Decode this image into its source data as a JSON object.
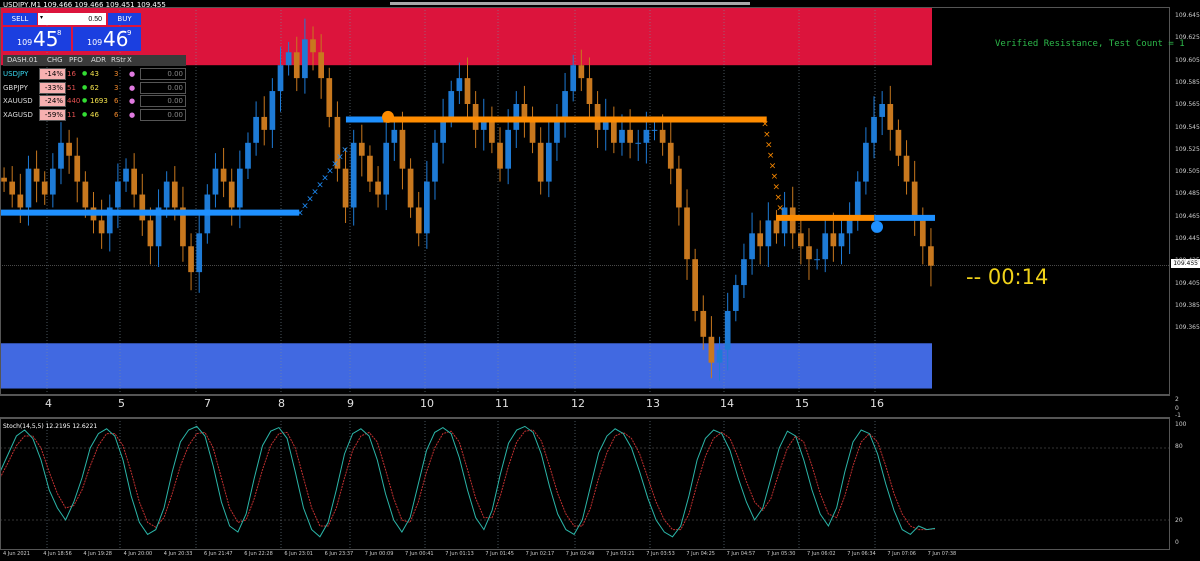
{
  "window": {
    "title": "USDJPY,M1  109.466 109.466 109.451 109.455"
  },
  "trade_panel": {
    "sell_label": "SELL",
    "buy_label": "BUY",
    "lot_value": "0.50",
    "sell_price": {
      "small": "109",
      "big": "45",
      "sup": "8"
    },
    "buy_price": {
      "small": "109",
      "big": "46",
      "sup": "9"
    }
  },
  "dashboard": {
    "headers": [
      "DASH.01",
      "CHG",
      "PFO",
      "ADR",
      "RStr",
      "X"
    ],
    "rows": [
      {
        "symbol": "USDJPY",
        "chg": "-14%",
        "pfo": "16",
        "adr": "43",
        "rstr": "3",
        "value": "0.00",
        "symbol_color": "#39d7f0"
      },
      {
        "symbol": "GBPJPY",
        "chg": "-33%",
        "pfo": "51",
        "adr": "62",
        "rstr": "3",
        "value": "0.00",
        "symbol_color": "#dddddd"
      },
      {
        "symbol": "XAUUSD",
        "chg": "-24%",
        "pfo": "440",
        "adr": "1693",
        "rstr": "6",
        "value": "0.00",
        "symbol_color": "#dddddd"
      },
      {
        "symbol": "XAGUSD",
        "chg": "-59%",
        "pfo": "11",
        "adr": "46",
        "rstr": "6",
        "value": "0.00",
        "symbol_color": "#dddddd"
      }
    ]
  },
  "annotations": {
    "resistance": "Verified Resistance, Test Count = 1",
    "timer": "-- 00:14",
    "current_price": "109.455"
  },
  "price_axis": [
    "109.645",
    "109.625",
    "109.605",
    "109.585",
    "109.565",
    "109.545",
    "109.525",
    "109.505",
    "109.485",
    "109.465",
    "109.445",
    "109.425",
    "109.405",
    "109.385",
    "109.365"
  ],
  "x_markers": [
    "4",
    "5",
    "7",
    "8",
    "9",
    "10",
    "11",
    "12",
    "13",
    "14",
    "15",
    "16"
  ],
  "separator_axis": [
    "2",
    "0",
    "-1"
  ],
  "stoch": {
    "label": "Stoch(14,5,5) 12.2195 12.6221",
    "levels": [
      "100",
      "80",
      "20",
      "0"
    ]
  },
  "time_axis": [
    "4 Jun 2021",
    "4 Jun 18:56",
    "4 Jun 19:28",
    "4 Jun 20:00",
    "4 Jun 20:33",
    "6 Jun 21:47",
    "6 Jun 22:28",
    "6 Jun 23:01",
    "6 Jun 23:37",
    "7 Jun 00:09",
    "7 Jun 00:41",
    "7 Jun 01:13",
    "7 Jun 01:45",
    "7 Jun 02:17",
    "7 Jun 02:49",
    "7 Jun 03:21",
    "7 Jun 03:53",
    "7 Jun 04:25",
    "7 Jun 04:57",
    "7 Jun 05:30",
    "7 Jun 06:02",
    "7 Jun 06:34",
    "7 Jun 07:06",
    "7 Jun 07:38"
  ],
  "colors": {
    "resistance_zone": "#dc143c",
    "support_zone": "#4169e1",
    "bull_candle": "#1e7bd6",
    "bear_candle": "#c8781e",
    "level_blue": "#1e90ff",
    "level_orange": "#ff8c00",
    "stoch_main": "#2bb5a8",
    "stoch_signal": "#c23030",
    "timer": "#f0d21a",
    "resistance_text": "#2db84a"
  },
  "chart_data": {
    "type": "candlestick",
    "price_range": [
      109.355,
      109.655
    ],
    "zones": [
      {
        "kind": "resistance",
        "from": 109.61,
        "to": 109.66
      },
      {
        "kind": "support",
        "from": 109.36,
        "to": 109.395
      }
    ],
    "close_series": [
      109.52,
      109.51,
      109.5,
      109.53,
      109.52,
      109.51,
      109.53,
      109.55,
      109.54,
      109.52,
      109.5,
      109.49,
      109.48,
      109.5,
      109.52,
      109.53,
      109.51,
      109.49,
      109.47,
      109.5,
      109.52,
      109.5,
      109.47,
      109.45,
      109.48,
      109.51,
      109.53,
      109.52,
      109.5,
      109.53,
      109.55,
      109.57,
      109.56,
      109.59,
      109.61,
      109.62,
      109.6,
      109.63,
      109.62,
      109.6,
      109.57,
      109.53,
      109.5,
      109.55,
      109.54,
      109.52,
      109.51,
      109.55,
      109.56,
      109.53,
      109.5,
      109.48,
      109.52,
      109.55,
      109.57,
      109.59,
      109.6,
      109.58,
      109.56,
      109.57,
      109.55,
      109.53,
      109.56,
      109.58,
      109.57,
      109.55,
      109.52,
      109.55,
      109.57,
      109.59,
      109.61,
      109.6,
      109.58,
      109.56,
      109.57,
      109.55,
      109.56,
      109.55,
      109.55,
      109.56,
      109.56,
      109.55,
      109.53,
      109.5,
      109.46,
      109.42,
      109.4,
      109.38,
      109.39,
      109.42,
      109.44,
      109.46,
      109.48,
      109.47,
      109.49,
      109.48,
      109.5,
      109.48,
      109.47,
      109.46,
      109.46,
      109.48,
      109.47,
      109.48,
      109.49,
      109.52,
      109.55,
      109.57,
      109.58,
      109.56,
      109.54,
      109.52,
      109.49,
      109.47,
      109.455
    ],
    "levels": [
      {
        "color": "blue",
        "price": 109.496,
        "from": 0.0,
        "to": 0.32
      },
      {
        "color": "blue",
        "price": 109.568,
        "from": 0.37,
        "to": 0.41
      },
      {
        "color": "orange",
        "price": 109.568,
        "from": 0.41,
        "to": 0.82
      },
      {
        "color": "orange",
        "price": 109.492,
        "from": 0.83,
        "to": 0.935
      },
      {
        "color": "blue",
        "price": 109.492,
        "from": 0.935,
        "to": 1.0
      }
    ],
    "stoch_k": [
      60,
      75,
      90,
      95,
      88,
      70,
      45,
      30,
      20,
      35,
      55,
      80,
      92,
      96,
      90,
      70,
      40,
      18,
      8,
      12,
      30,
      60,
      85,
      95,
      98,
      90,
      65,
      35,
      15,
      10,
      25,
      55,
      82,
      94,
      97,
      88,
      60,
      30,
      12,
      6,
      18,
      45,
      75,
      92,
      96,
      90,
      70,
      42,
      20,
      10,
      22,
      50,
      78,
      93,
      97,
      92,
      72,
      45,
      22,
      12,
      28,
      58,
      84,
      95,
      98,
      93,
      75,
      48,
      25,
      12,
      8,
      20,
      48,
      76,
      90,
      96,
      92,
      80,
      60,
      38,
      20,
      10,
      6,
      15,
      40,
      70,
      88,
      95,
      92,
      78,
      55,
      35,
      20,
      30,
      55,
      80,
      94,
      90,
      70,
      45,
      25,
      15,
      30,
      60,
      85,
      95,
      92,
      75,
      50,
      28,
      12,
      8,
      15,
      12,
      13
    ],
    "stoch_d": [
      55,
      68,
      82,
      90,
      90,
      80,
      60,
      42,
      30,
      32,
      45,
      65,
      82,
      92,
      92,
      82,
      60,
      35,
      18,
      14,
      22,
      42,
      65,
      82,
      92,
      93,
      80,
      55,
      30,
      18,
      20,
      38,
      62,
      82,
      92,
      93,
      80,
      55,
      30,
      15,
      15,
      30,
      55,
      78,
      90,
      93,
      85,
      62,
      38,
      20,
      18,
      35,
      60,
      80,
      92,
      94,
      85,
      62,
      38,
      22,
      22,
      40,
      65,
      85,
      94,
      95,
      86,
      65,
      42,
      25,
      15,
      15,
      30,
      55,
      76,
      90,
      93,
      88,
      75,
      55,
      35,
      20,
      12,
      12,
      25,
      50,
      73,
      88,
      93,
      88,
      72,
      52,
      35,
      28,
      38,
      60,
      80,
      90,
      85,
      65,
      42,
      25,
      22,
      40,
      65,
      85,
      92,
      85,
      65,
      42,
      25,
      15,
      12,
      12,
      12.6
    ]
  }
}
